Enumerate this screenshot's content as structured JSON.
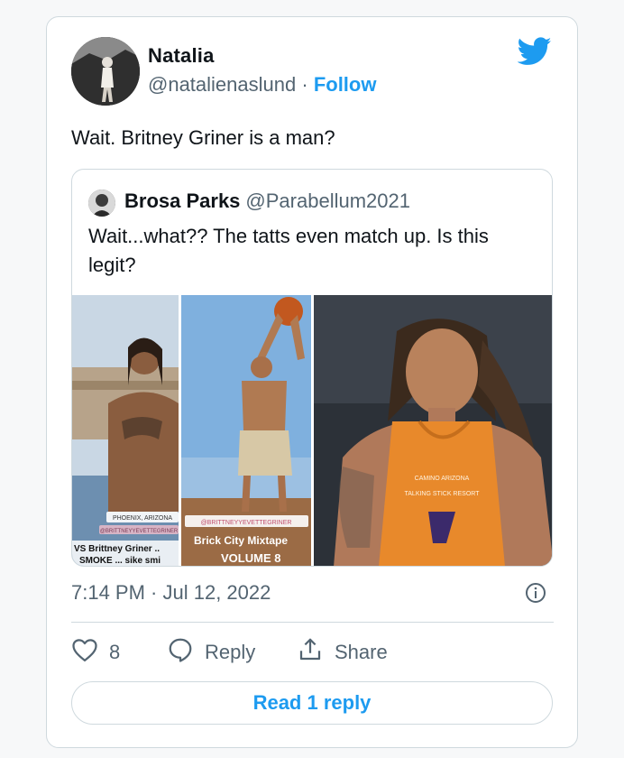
{
  "tweet": {
    "author_name": "Natalia",
    "author_handle": "@natalienaslund",
    "separator": "·",
    "follow_label": "Follow",
    "text": "Wait. Britney Griner is a man?",
    "timestamp": "7:14 PM · Jul 12, 2022"
  },
  "quoted_tweet": {
    "author_name": "Brosa Parks",
    "author_handle": "@Parabellum2021",
    "text": "Wait...what?? The tatts even match up. Is this legit?",
    "media": {
      "left_panel": {
        "location_tag": "PHOENIX, ARIZONA",
        "user_tag": "@BRITTNEYYEVETTEGRINER",
        "caption_line1": "VS Brittney Griner ..",
        "caption_line2": "SMOKE ... sike smi"
      },
      "middle_panel": {
        "user_tag": "@BRITTNEYYEVETTEGRINER",
        "caption_line1": "Brick City Mixtape",
        "caption_line2": "VOLUME 8"
      },
      "right_panel": {
        "jersey_text1": "CAMINO ARIZONA",
        "jersey_text2": "TALKING STICK RESORT"
      }
    }
  },
  "actions": {
    "like_count": "8",
    "reply_label": "Reply",
    "share_label": "Share",
    "read_replies_label": "Read 1 reply"
  },
  "icons": {
    "brand": "twitter-bird-icon",
    "info": "info-icon",
    "like": "heart-icon",
    "reply": "speech-bubble-icon",
    "share": "share-upload-icon"
  },
  "colors": {
    "accent": "#1d9bf0",
    "secondary_text": "#536471",
    "border": "#cfd9de",
    "jersey_orange": "#e8892b"
  }
}
